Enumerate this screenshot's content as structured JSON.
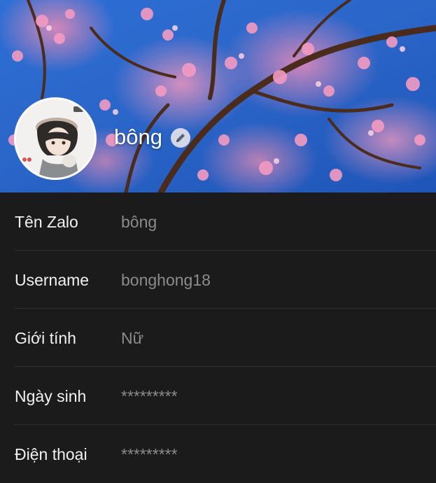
{
  "profile": {
    "display_name": "bông",
    "cover_photo": "cherry-blossom-cover",
    "avatar": "anime-avatar",
    "edit_icon": "pencil-icon"
  },
  "info_rows": [
    {
      "label": "Tên Zalo",
      "value": "bông"
    },
    {
      "label": "Username",
      "value": "bonghong18"
    },
    {
      "label": "Giới tính",
      "value": "Nữ"
    },
    {
      "label": "Ngày sinh",
      "value": "*********"
    },
    {
      "label": "Điện thoại",
      "value": "*********"
    }
  ],
  "colors": {
    "background": "#1b1b1b",
    "label": "#f1f1f1",
    "value": "#8c8c8c",
    "divider": "#2f2f2f",
    "sky": "#2b66c9",
    "blossom": "#ec8cb4"
  }
}
